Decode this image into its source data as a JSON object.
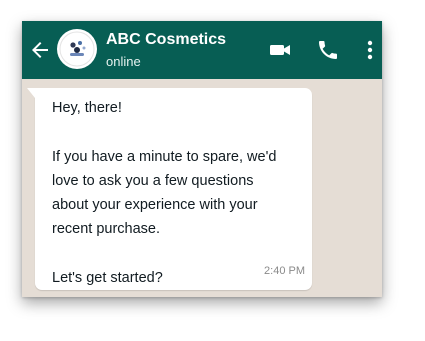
{
  "header": {
    "contact_name": "ABC Cosmetics",
    "status": "online",
    "background_color": "#075e54",
    "icons": [
      "back-arrow-icon",
      "video-call-icon",
      "phone-icon",
      "more-options-icon"
    ]
  },
  "message": {
    "lines": [
      "Hey, there!",
      "",
      "If you have a minute to spare, we'd",
      "love to ask you a few questions",
      "about your experience with your",
      "recent purchase.",
      "",
      "Let's get started?"
    ],
    "time": "2:40 PM"
  },
  "chat": {
    "background_color": "#e5ddd5"
  }
}
